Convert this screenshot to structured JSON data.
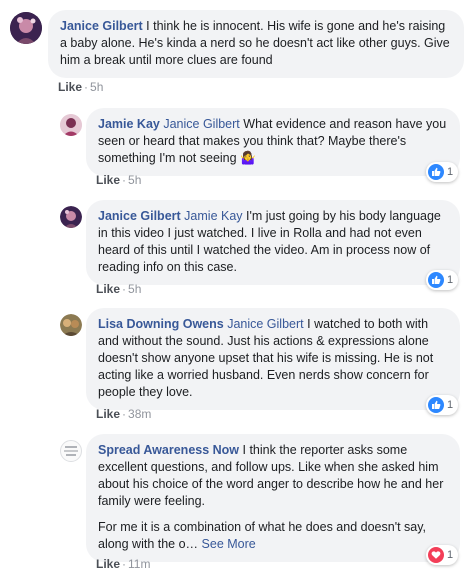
{
  "comments": [
    {
      "author": "Janice Gilbert",
      "mention": "",
      "text": "I think he is innocent. His wife is gone and he's raising a baby alone. He's kinda a nerd so he doesn't act like other guys. Give him a break until more clues are found",
      "like_label": "Like",
      "time": "5h",
      "reaction_count": ""
    },
    {
      "author": "Jamie Kay",
      "mention": "Janice Gilbert",
      "text": "What evidence and reason have you seen or heard that makes you think that? Maybe there's something I'm not seeing 🤷‍♀️",
      "like_label": "Like",
      "time": "5h",
      "reaction_count": "1"
    },
    {
      "author": "Janice Gilbert",
      "mention": "Jamie Kay",
      "text": "I'm just going by his body language in this video I just watched. I live in Rolla and had not even heard of this until I watched the video. Am in process now of reading info on this case.",
      "like_label": "Like",
      "time": "5h",
      "reaction_count": "1"
    },
    {
      "author": "Lisa Downing Owens",
      "mention": "Janice Gilbert",
      "text": "I watched to both with and without the sound. Just his actions & expressions alone doesn't show anyone upset that his wife is missing. He is not acting like a worried husband. Even nerds show concern for people they love.",
      "like_label": "Like",
      "time": "38m",
      "reaction_count": "1"
    },
    {
      "author": "Spread Awareness Now",
      "mention": "",
      "text": "I think the reporter asks some excellent questions, and follow ups. Like when she asked him about his choice of the word anger to describe how he and her family were feeling.",
      "text2": "For me it is a combination of what he does and doesn't say, along with the o…",
      "see_more": "See More",
      "like_label": "Like",
      "time": "11m",
      "reaction_count": "1"
    }
  ],
  "colors": {
    "link_blue": "#385898",
    "bubble_bg": "#f2f3f5",
    "like_blue": "#2d88ff",
    "love_red": "#f33e58"
  }
}
